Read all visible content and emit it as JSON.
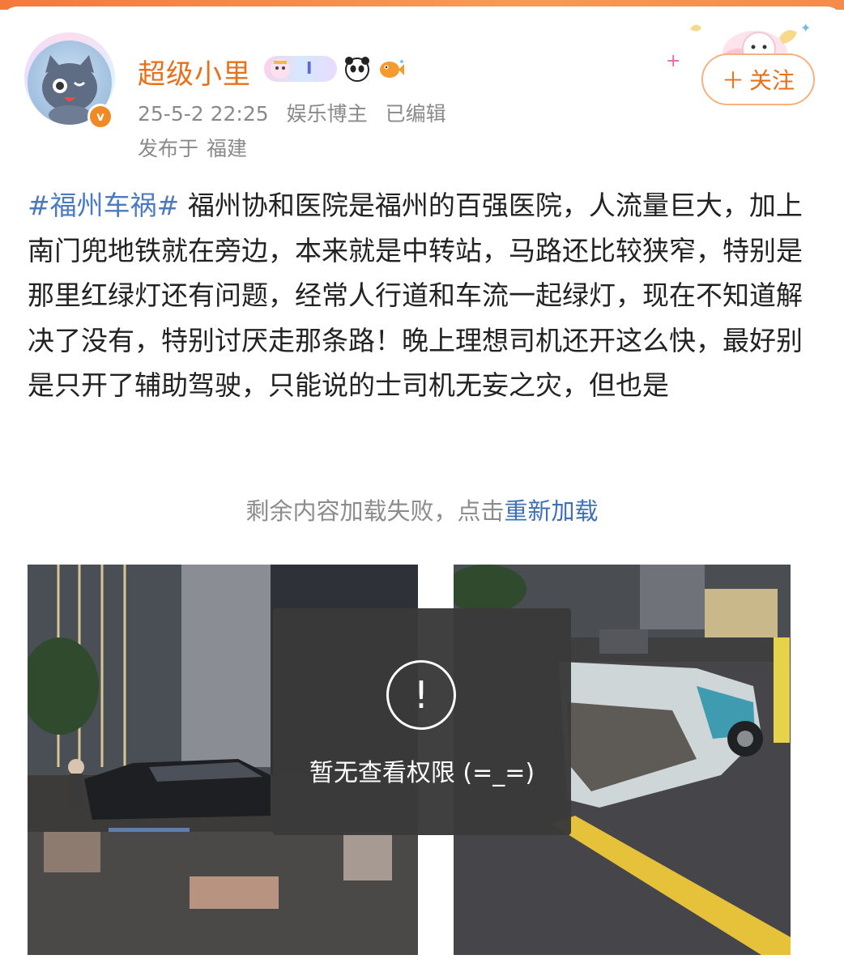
{
  "post": {
    "author": {
      "name": "超级小里",
      "verified_badge": "v",
      "badges": [
        "fan-badge-pill",
        "panda-icon",
        "fish-icon"
      ],
      "badge_pill_text": "I"
    },
    "meta": {
      "date": "25-5-2 22:25",
      "role": "娱乐博主",
      "edited": "已编辑"
    },
    "location": {
      "prefix": "发布于",
      "place": "福建"
    },
    "follow_button": {
      "icon": "＋",
      "label": "关注"
    },
    "hashtag": "#福州车祸#",
    "text": "福州协和医院是福州的百强医院，人流量巨大，加上南门兜地铁就在旁边，本来就是中转站，马路还比较狭窄，特别是那里红绿灯还有问题，经常人行道和车流一起绿灯，现在不知道解决了没有，特别讨厌走那条路！晚上理想司机还开这么快，最好别是只开了辅助驾驶，只能说的士司机无妄之灾，但也是",
    "load_error": {
      "message": "剩余内容加载失败，点击",
      "action": "重新加载"
    },
    "images": {
      "overlay": {
        "icon": "!",
        "text": "暂无查看权限 (=_=)"
      }
    }
  },
  "colors": {
    "accent": "#e8701a",
    "hashtag": "#4a7bc0",
    "link": "#3e6fb8",
    "meta": "#8a8a8a"
  }
}
